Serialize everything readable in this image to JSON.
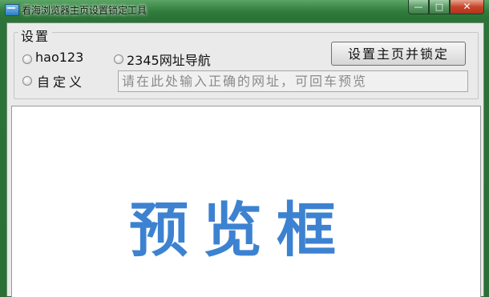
{
  "window": {
    "title": "看海浏览器主页设置锁定工具",
    "minimize_glyph": "—",
    "maximize_glyph": "□",
    "close_glyph": "✕"
  },
  "settings": {
    "group_label": "设置",
    "options": [
      {
        "label": "hao123",
        "selected": false
      },
      {
        "label": "2345网址导航",
        "selected": false
      },
      {
        "label": "自定义",
        "selected": false
      }
    ],
    "lock_button": "设置主页并锁定",
    "url_placeholder": "请在此处输入正确的网址，可回车预览",
    "url_value": ""
  },
  "preview": {
    "text": "预览框"
  },
  "colors": {
    "title_bar": "#2f7c3c",
    "preview_text": "#3d82d1",
    "close_button": "#c7442b"
  },
  "icons": {
    "app": "browser-window-icon",
    "radio": "radio-button-icon"
  }
}
